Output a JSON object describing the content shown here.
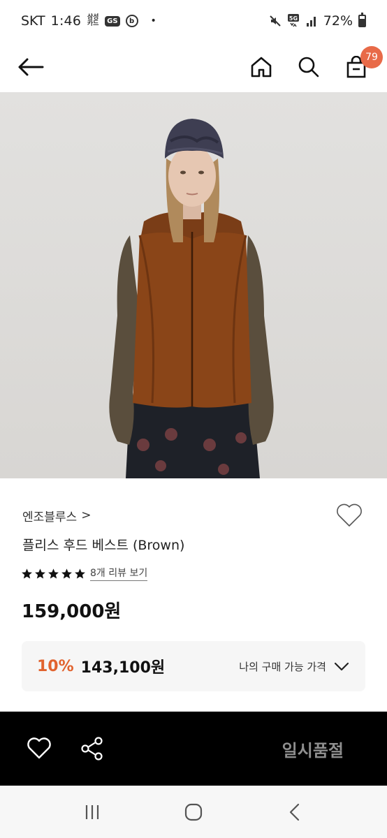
{
  "status_bar": {
    "carrier": "SKT",
    "time": "1:46",
    "samsung_card_label": "삼성 카드",
    "gs_label": "GS",
    "b_label": "b",
    "network": "5G",
    "battery": "72%",
    "battery_level": 0.72
  },
  "header": {
    "cart_count": "79"
  },
  "product": {
    "image_alt": "Model wearing brown fleece hooded vest",
    "brand": "엔조블루스",
    "brand_chevron": ">",
    "name": "플리스 후드 베스트 (Brown)",
    "rating": 5,
    "review_link": "8개 리뷰 보기",
    "price": "159,000원",
    "discount_rate": "10%",
    "discount_price": "143,100원",
    "price_toggle_label": "나의 구매 가능 가격"
  },
  "action_bar": {
    "soldout_label": "일시품절"
  },
  "colors": {
    "accent": "#e86a48",
    "discount": "#e1632f",
    "action_bar_bg": "#000000",
    "soldout_text": "#8e8e8e"
  },
  "icons": {
    "back": "arrow-left-icon",
    "home": "home-icon",
    "search": "search-icon",
    "cart": "shopping-bag-icon",
    "wish": "heart-icon",
    "share": "share-icon",
    "chevron": "chevron-down-icon",
    "recents": "recents-icon",
    "home_sys": "home-circle-icon",
    "back_sys": "chevron-left-icon"
  }
}
